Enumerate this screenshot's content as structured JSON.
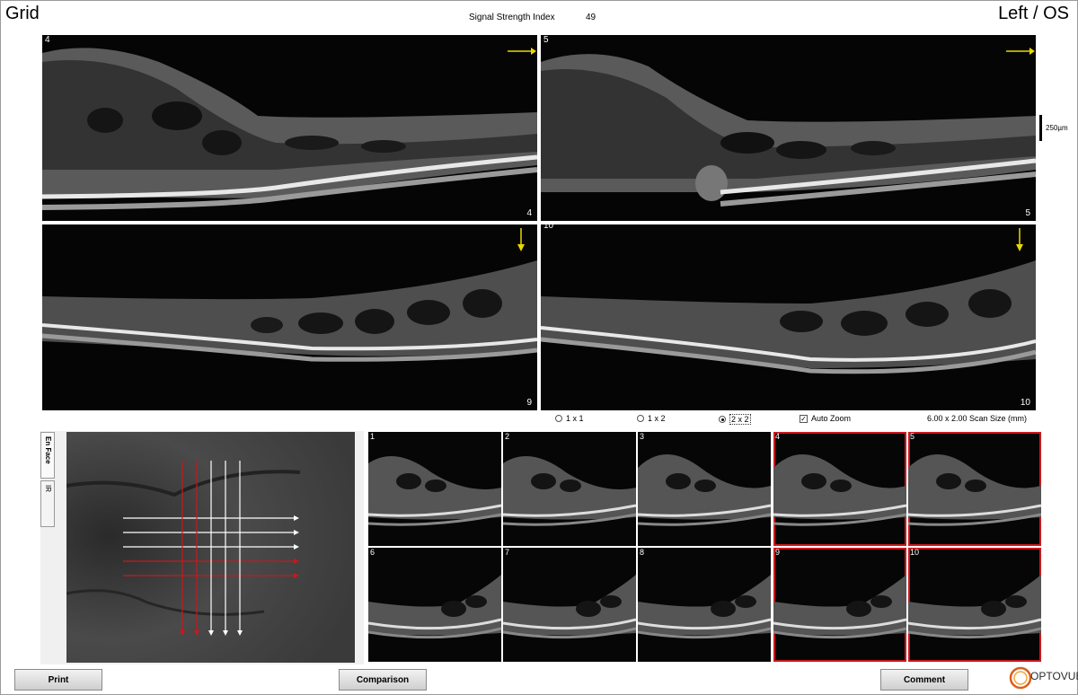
{
  "header": {
    "title": "Grid",
    "eye": "Left / OS",
    "ssi_label": "Signal Strength Index",
    "ssi_value": "49"
  },
  "scale_bar": {
    "label": "250µm"
  },
  "large_scans": [
    {
      "number": "4"
    },
    {
      "number": "5"
    },
    {
      "number": "9"
    },
    {
      "number": "10"
    }
  ],
  "layout_options": {
    "opt1": "1 x 1",
    "opt2": "1 x 2",
    "opt3": "2 x 2",
    "selected": "2 x 2",
    "auto_zoom_label": "Auto Zoom",
    "auto_zoom_checked": true,
    "scan_size": "6.00 x 2.00 Scan Size (mm)"
  },
  "tabs": {
    "enface": "En Face",
    "ir": "IR"
  },
  "thumbnails": [
    {
      "number": "1",
      "selected": false
    },
    {
      "number": "2",
      "selected": false
    },
    {
      "number": "3",
      "selected": false
    },
    {
      "number": "4",
      "selected": true
    },
    {
      "number": "5",
      "selected": true
    },
    {
      "number": "6",
      "selected": false
    },
    {
      "number": "7",
      "selected": false
    },
    {
      "number": "8",
      "selected": false
    },
    {
      "number": "9",
      "selected": true
    },
    {
      "number": "10",
      "selected": true
    }
  ],
  "buttons": {
    "print": "Print",
    "comparison": "Comparison",
    "comment": "Comment"
  },
  "brand": {
    "logo_text": "OPTOVUE"
  },
  "colors": {
    "selection_red": "#c8181e",
    "arrow_yellow": "#e8d800",
    "scan_bg": "#050505"
  }
}
